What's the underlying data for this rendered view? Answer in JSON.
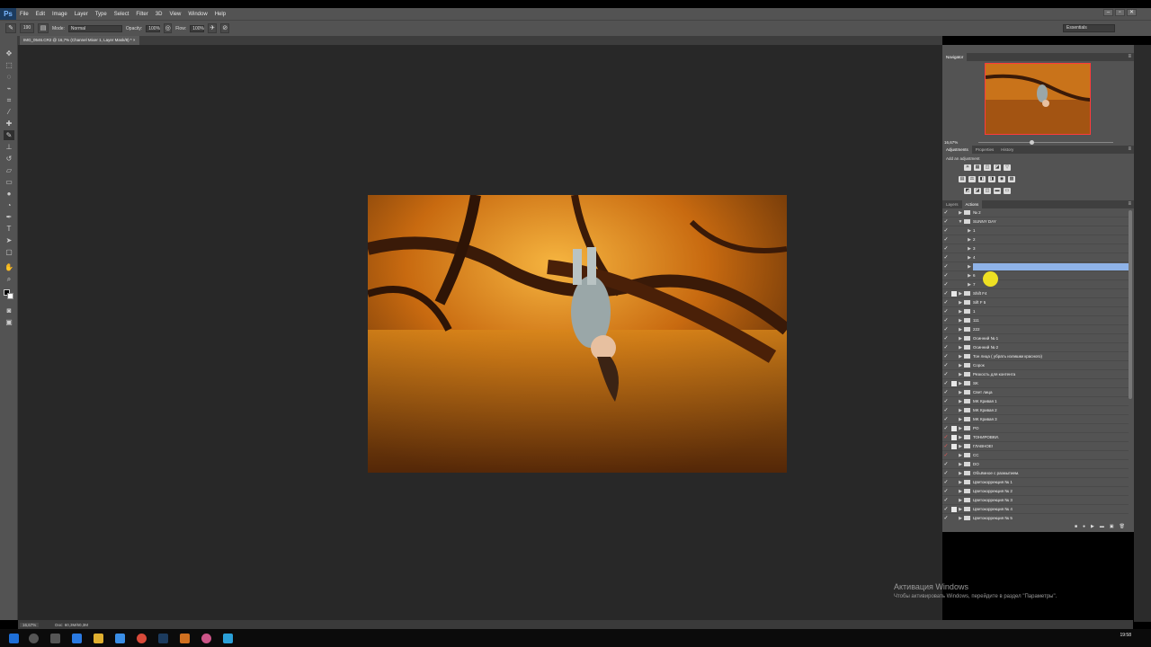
{
  "app": {
    "logo": "Ps"
  },
  "menu": [
    "File",
    "Edit",
    "Image",
    "Layer",
    "Type",
    "Select",
    "Filter",
    "3D",
    "View",
    "Window",
    "Help"
  ],
  "window_controls": [
    "–",
    "▫",
    "✕"
  ],
  "options_bar": {
    "brush_size": "190",
    "mode_label": "Mode:",
    "mode_value": "Normal",
    "opacity_label": "Opacity:",
    "opacity_value": "100%",
    "flow_label": "Flow:",
    "flow_value": "100%",
    "workspace": "Essentials"
  },
  "document_tab": "IMG_0546.CR2 @ 16,7% (Channel Mixer 1, Layer Mask/8) * ×",
  "status_bar": {
    "zoom": "16,67%",
    "doc": "Doc: 60,3M/60,3M"
  },
  "navigator": {
    "tab": "Navigator",
    "zoom": "16,67%"
  },
  "adjustments": {
    "tabs": [
      "Adjustments",
      "Properties",
      "History"
    ],
    "add_label": "Add an adjustment",
    "rows": [
      [
        "☀",
        "▦",
        "◫",
        "◪",
        "▽"
      ],
      [
        "▤",
        "⚖",
        "◧",
        "◨",
        "◉",
        "▩"
      ],
      [
        "◩",
        "◪",
        "◫",
        "▬",
        "▭"
      ]
    ]
  },
  "actions": {
    "tabs": [
      "Layers",
      "Actions"
    ],
    "footer": [
      "■",
      "●",
      "▶",
      "▬",
      "▣",
      "🗑"
    ],
    "rows": [
      {
        "name": "№ 2",
        "check": "✓",
        "dialog": false,
        "kind": "set",
        "open": false,
        "red": false
      },
      {
        "name": "SUNNY DAY",
        "check": "✓",
        "dialog": false,
        "kind": "set",
        "open": true,
        "red": false
      },
      {
        "name": "1",
        "check": "✓",
        "dialog": false,
        "kind": "action",
        "red": false
      },
      {
        "name": "2",
        "check": "✓",
        "dialog": false,
        "kind": "action",
        "red": false
      },
      {
        "name": "3",
        "check": "✓",
        "dialog": false,
        "kind": "action",
        "red": false
      },
      {
        "name": "4",
        "check": "✓",
        "dialog": false,
        "kind": "action",
        "red": false
      },
      {
        "name": "",
        "check": "✓",
        "dialog": false,
        "kind": "action",
        "red": false,
        "selected": true
      },
      {
        "name": "6",
        "check": "✓",
        "dialog": false,
        "kind": "action",
        "red": false
      },
      {
        "name": "7",
        "check": "✓",
        "dialog": false,
        "kind": "action",
        "red": false
      },
      {
        "name": "Shift F4",
        "check": "✓",
        "dialog": true,
        "kind": "set",
        "open": false,
        "red": false
      },
      {
        "name": "Sift F 5",
        "check": "✓",
        "dialog": false,
        "kind": "set",
        "open": false,
        "red": false
      },
      {
        "name": "1",
        "check": "✓",
        "dialog": false,
        "kind": "set",
        "open": false,
        "red": false
      },
      {
        "name": "111",
        "check": "✓",
        "dialog": false,
        "kind": "set",
        "open": false,
        "red": false
      },
      {
        "name": "222",
        "check": "✓",
        "dialog": false,
        "kind": "set",
        "open": false,
        "red": false
      },
      {
        "name": "Осинний № 1",
        "check": "✓",
        "dialog": false,
        "kind": "set",
        "open": false,
        "red": false
      },
      {
        "name": "Осинний № 2",
        "check": "✓",
        "dialog": false,
        "kind": "set",
        "open": false,
        "red": false
      },
      {
        "name": "Тон лица ( убрать излишки красного)",
        "check": "✓",
        "dialog": false,
        "kind": "set",
        "open": false,
        "red": false
      },
      {
        "name": "Сорок",
        "check": "✓",
        "dialog": false,
        "kind": "set",
        "open": false,
        "red": false
      },
      {
        "name": "Резкость для контента",
        "check": "✓",
        "dialog": false,
        "kind": "set",
        "open": false,
        "red": false
      },
      {
        "name": "SK",
        "check": "✓",
        "dialog": true,
        "kind": "set",
        "open": false,
        "red": false
      },
      {
        "name": "Свет лица",
        "check": "✓",
        "dialog": false,
        "kind": "set",
        "open": false,
        "red": false
      },
      {
        "name": "MK Кривая 1",
        "check": "✓",
        "dialog": false,
        "kind": "set",
        "open": false,
        "red": false
      },
      {
        "name": "MK Кривая 2",
        "check": "✓",
        "dialog": false,
        "kind": "set",
        "open": false,
        "red": false
      },
      {
        "name": "MK Кривая 3",
        "check": "✓",
        "dialog": false,
        "kind": "set",
        "open": false,
        "red": false
      },
      {
        "name": "PO",
        "check": "✓",
        "dialog": true,
        "kind": "set",
        "open": false,
        "red": false
      },
      {
        "name": "ТОНИРОВКИ.",
        "check": "✓",
        "dialog": true,
        "kind": "set",
        "open": false,
        "red": true
      },
      {
        "name": "ГЛАВНОЕ!",
        "check": "✓",
        "dialog": true,
        "kind": "set",
        "open": false,
        "red": true
      },
      {
        "name": "CC",
        "check": "✓",
        "dialog": false,
        "kind": "set",
        "open": false,
        "red": true
      },
      {
        "name": "DO",
        "check": "✓",
        "dialog": false,
        "kind": "set",
        "open": false,
        "red": false
      },
      {
        "name": "Объёмное с размытием.",
        "check": "✓",
        "dialog": false,
        "kind": "set",
        "open": false,
        "red": false
      },
      {
        "name": "Цветокоррекция № 1",
        "check": "✓",
        "dialog": false,
        "kind": "set",
        "open": false,
        "red": false
      },
      {
        "name": "Цветокоррекция № 2",
        "check": "✓",
        "dialog": false,
        "kind": "set",
        "open": false,
        "red": false
      },
      {
        "name": "Цветокоррекция № 3",
        "check": "✓",
        "dialog": false,
        "kind": "set",
        "open": false,
        "red": false
      },
      {
        "name": "Цветокоррекция № 4",
        "check": "✓",
        "dialog": true,
        "kind": "set",
        "open": false,
        "red": false
      },
      {
        "name": "Цветокоррекция № 5",
        "check": "✓",
        "dialog": false,
        "kind": "set",
        "open": false,
        "red": false
      }
    ]
  },
  "windows_notice": {
    "title": "Активация Windows",
    "subtitle": "Чтобы активировать Windows, перейдите в раздел \"Параметры\"."
  },
  "taskbar": {
    "clock": "19:58"
  },
  "colors": {
    "panel": "#535353",
    "canvas": "#282828",
    "selection": "#8fb3e8",
    "accent_red": "#e05a5a"
  }
}
